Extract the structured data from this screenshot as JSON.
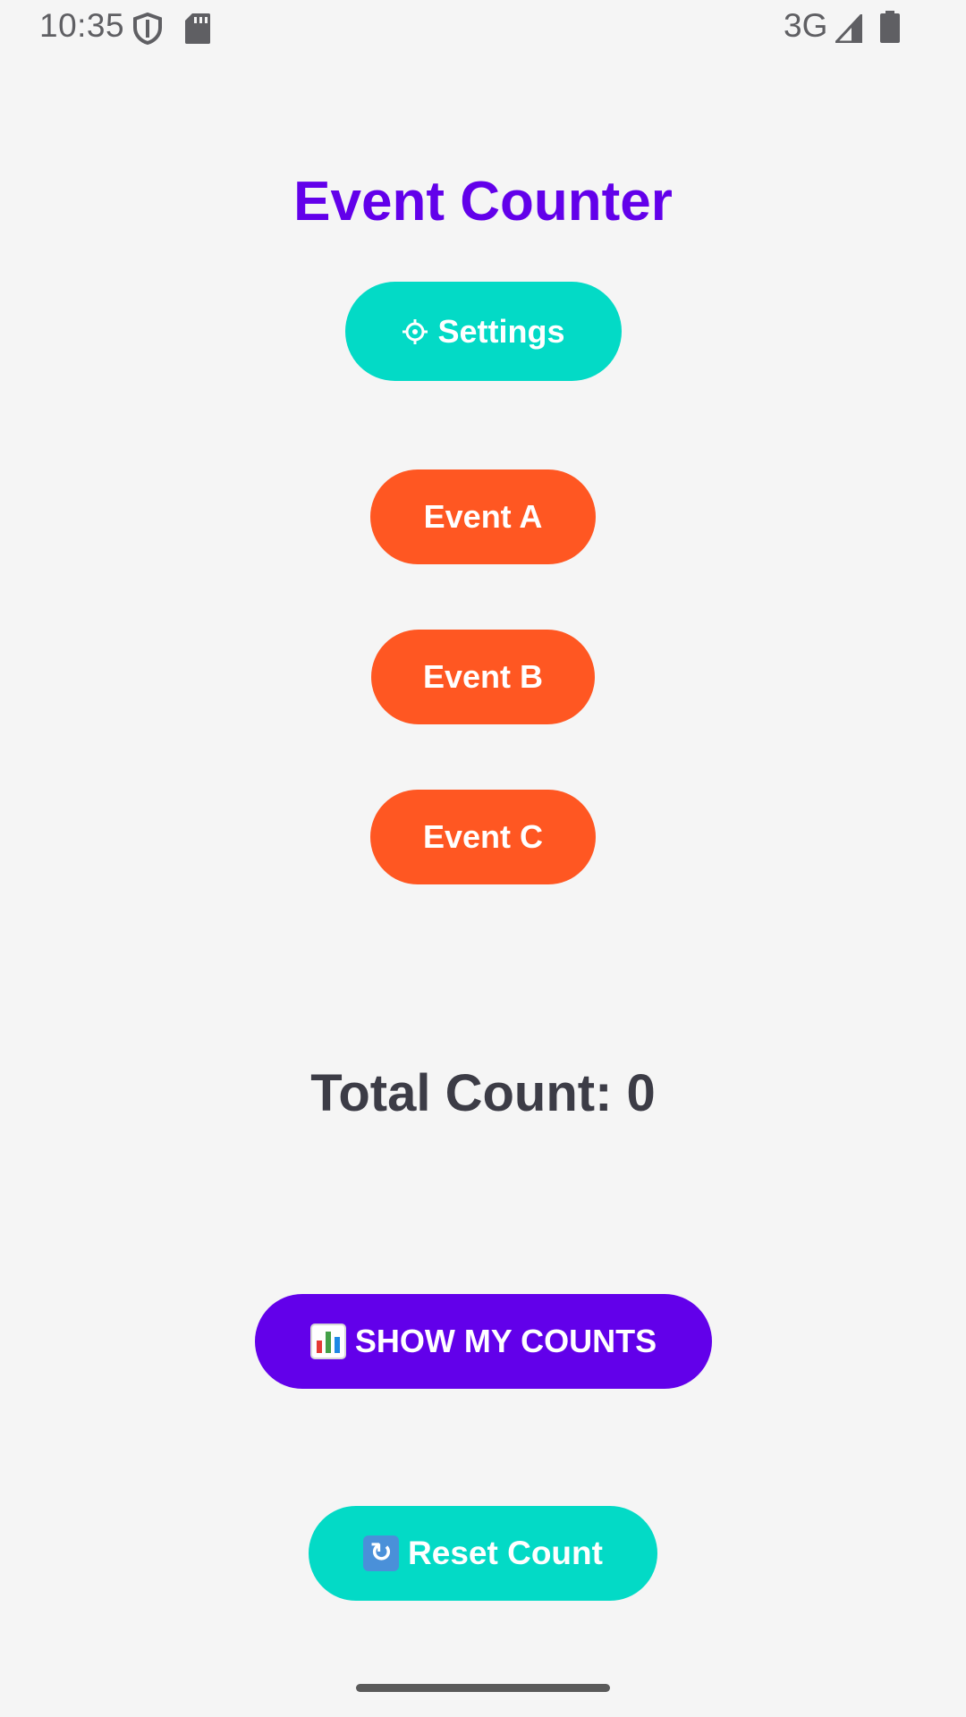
{
  "status_bar": {
    "time": "10:35",
    "network": "3G",
    "icons": [
      "shield-icon",
      "sd-card-icon",
      "signal-icon",
      "battery-icon"
    ]
  },
  "app": {
    "title": "Event Counter"
  },
  "buttons": {
    "settings_label": "Settings",
    "event_a_label": "Event A",
    "event_b_label": "Event B",
    "event_c_label": "Event C",
    "show_counts_label": "SHOW MY COUNTS",
    "reset_label": "Reset Count"
  },
  "counter": {
    "total_text": "Total Count: 0"
  },
  "colors": {
    "primary": "#6200ea",
    "teal": "#03dac6",
    "orange": "#ff5722",
    "background": "#f5f5f5",
    "text_dark": "#3c3c46"
  }
}
